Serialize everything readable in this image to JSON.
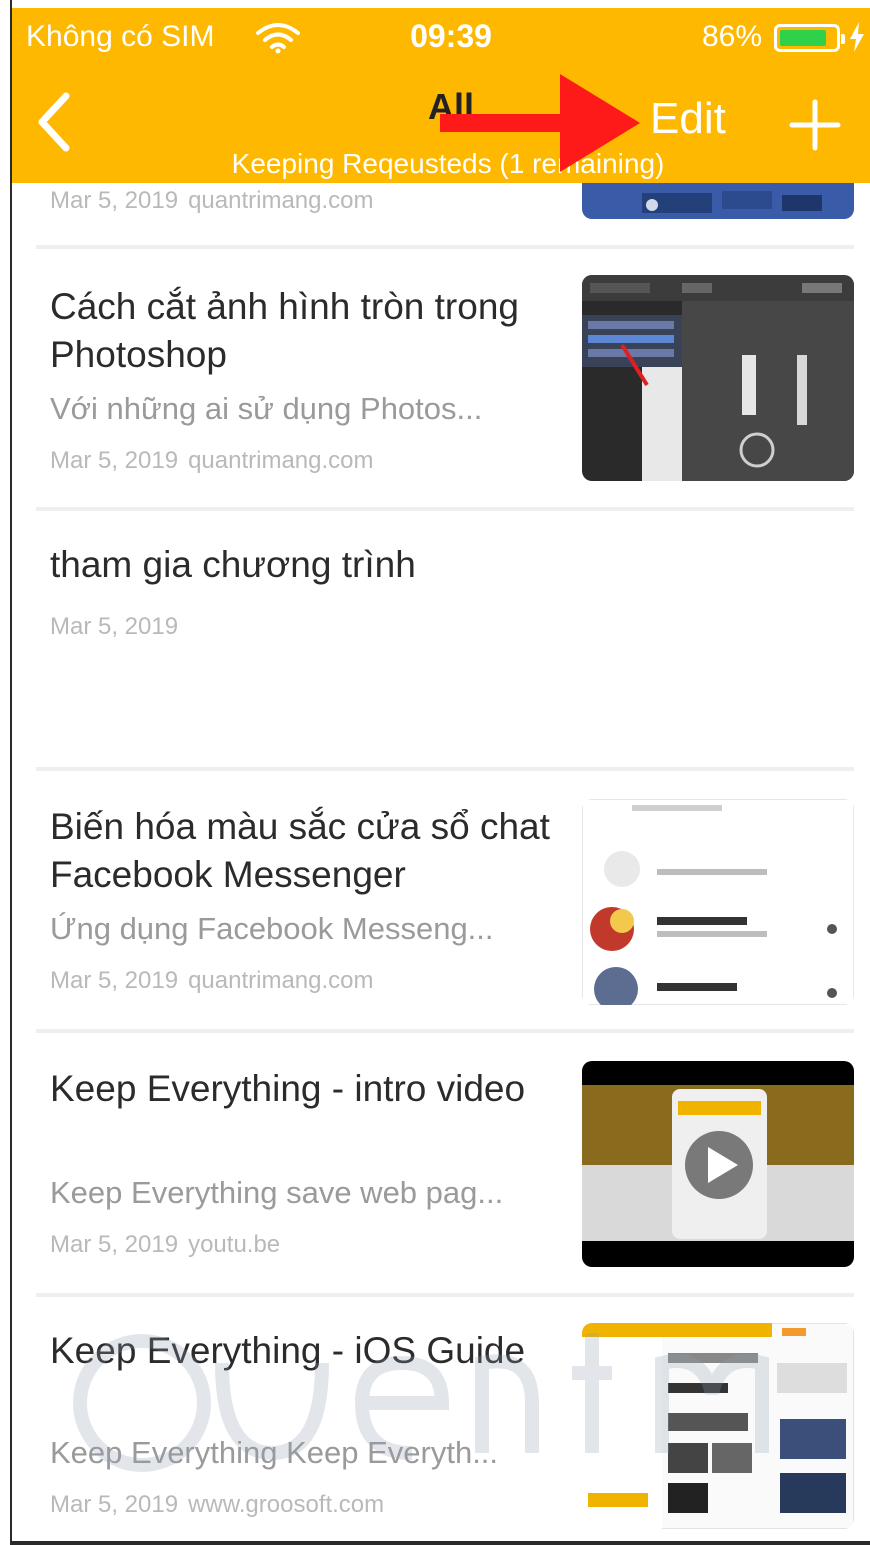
{
  "status_bar": {
    "carrier": "Không có SIM",
    "time": "09:39",
    "battery_percent": "86%",
    "battery_level": 0.86,
    "battery_fill_color": "#2fd14a",
    "icons": [
      "wifi-icon",
      "battery-icon",
      "charging-bolt-icon"
    ]
  },
  "nav": {
    "title": "All",
    "subtitle": "Keeping Reqeusteds (1 remaining)",
    "edit_label": "Edit",
    "icons": [
      "back-chevron-icon",
      "plus-icon"
    ]
  },
  "annotation": {
    "description_icon": "red-arrow-pointing-to-edit",
    "color": "#ff1a1a"
  },
  "theme": {
    "header_color": "#ffb800",
    "divider_color": "#efefef"
  },
  "items": [
    {
      "title": "",
      "excerpt": "",
      "date": "Mar 5, 2019",
      "source": "quantrimang.com",
      "thumbnail": "blue-screenshot"
    },
    {
      "title": "Cách cắt ảnh hình tròn trong Photoshop",
      "excerpt": "Với những ai sử dụng Photos...",
      "date": "Mar 5, 2019",
      "source": "quantrimang.com",
      "thumbnail": "photoshop-dark-screenshot"
    },
    {
      "title": "tham gia chương trình",
      "excerpt": "",
      "date": "Mar 5, 2019",
      "source": "",
      "thumbnail": ""
    },
    {
      "title": "Biến hóa màu sắc cửa sổ chat Facebook Messenger",
      "excerpt": "Ứng dụng Facebook Messeng...",
      "date": "Mar 5, 2019",
      "source": "quantrimang.com",
      "thumbnail": "messenger-chat-list"
    },
    {
      "title": "Keep Everything - intro video",
      "excerpt": "Keep Everything save web pag...",
      "date": "Mar 5, 2019",
      "source": "youtu.be",
      "thumbnail": "video-play-screenshot"
    },
    {
      "title": "Keep Everything - iOS Guide",
      "excerpt": "Keep Everything  Keep Everyth...",
      "date": "Mar 5, 2019",
      "source": "www.groosoft.com",
      "thumbnail": "ios-guide-screenshot"
    }
  ]
}
